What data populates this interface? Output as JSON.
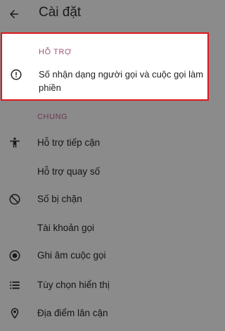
{
  "header": {
    "back_icon": "arrow-left-icon",
    "title": "Cài đặt"
  },
  "support": {
    "section_label": "HỖ TRỢ",
    "item": {
      "icon": "info-circle-icon",
      "label": "Số nhận dạng người gọi và cuộc gọi làm phiền"
    },
    "highlight_color": "#e0171c"
  },
  "general": {
    "section_label": "CHUNG",
    "items": [
      {
        "label": "Hỗ trợ tiếp cận",
        "icon": "accessibility-icon"
      },
      {
        "label": "Hỗ trợ quay số",
        "icon": ""
      },
      {
        "label": "Số bị chặn",
        "icon": "block-icon"
      },
      {
        "label": "Tài khoản gọi",
        "icon": ""
      },
      {
        "label": "Ghi âm cuộc gọi",
        "icon": "record-icon"
      },
      {
        "label": "Tùy chọn hiển thị",
        "icon": "list-icon"
      },
      {
        "label": "Địa điểm lân cận",
        "icon": "location-pin-icon"
      }
    ]
  }
}
